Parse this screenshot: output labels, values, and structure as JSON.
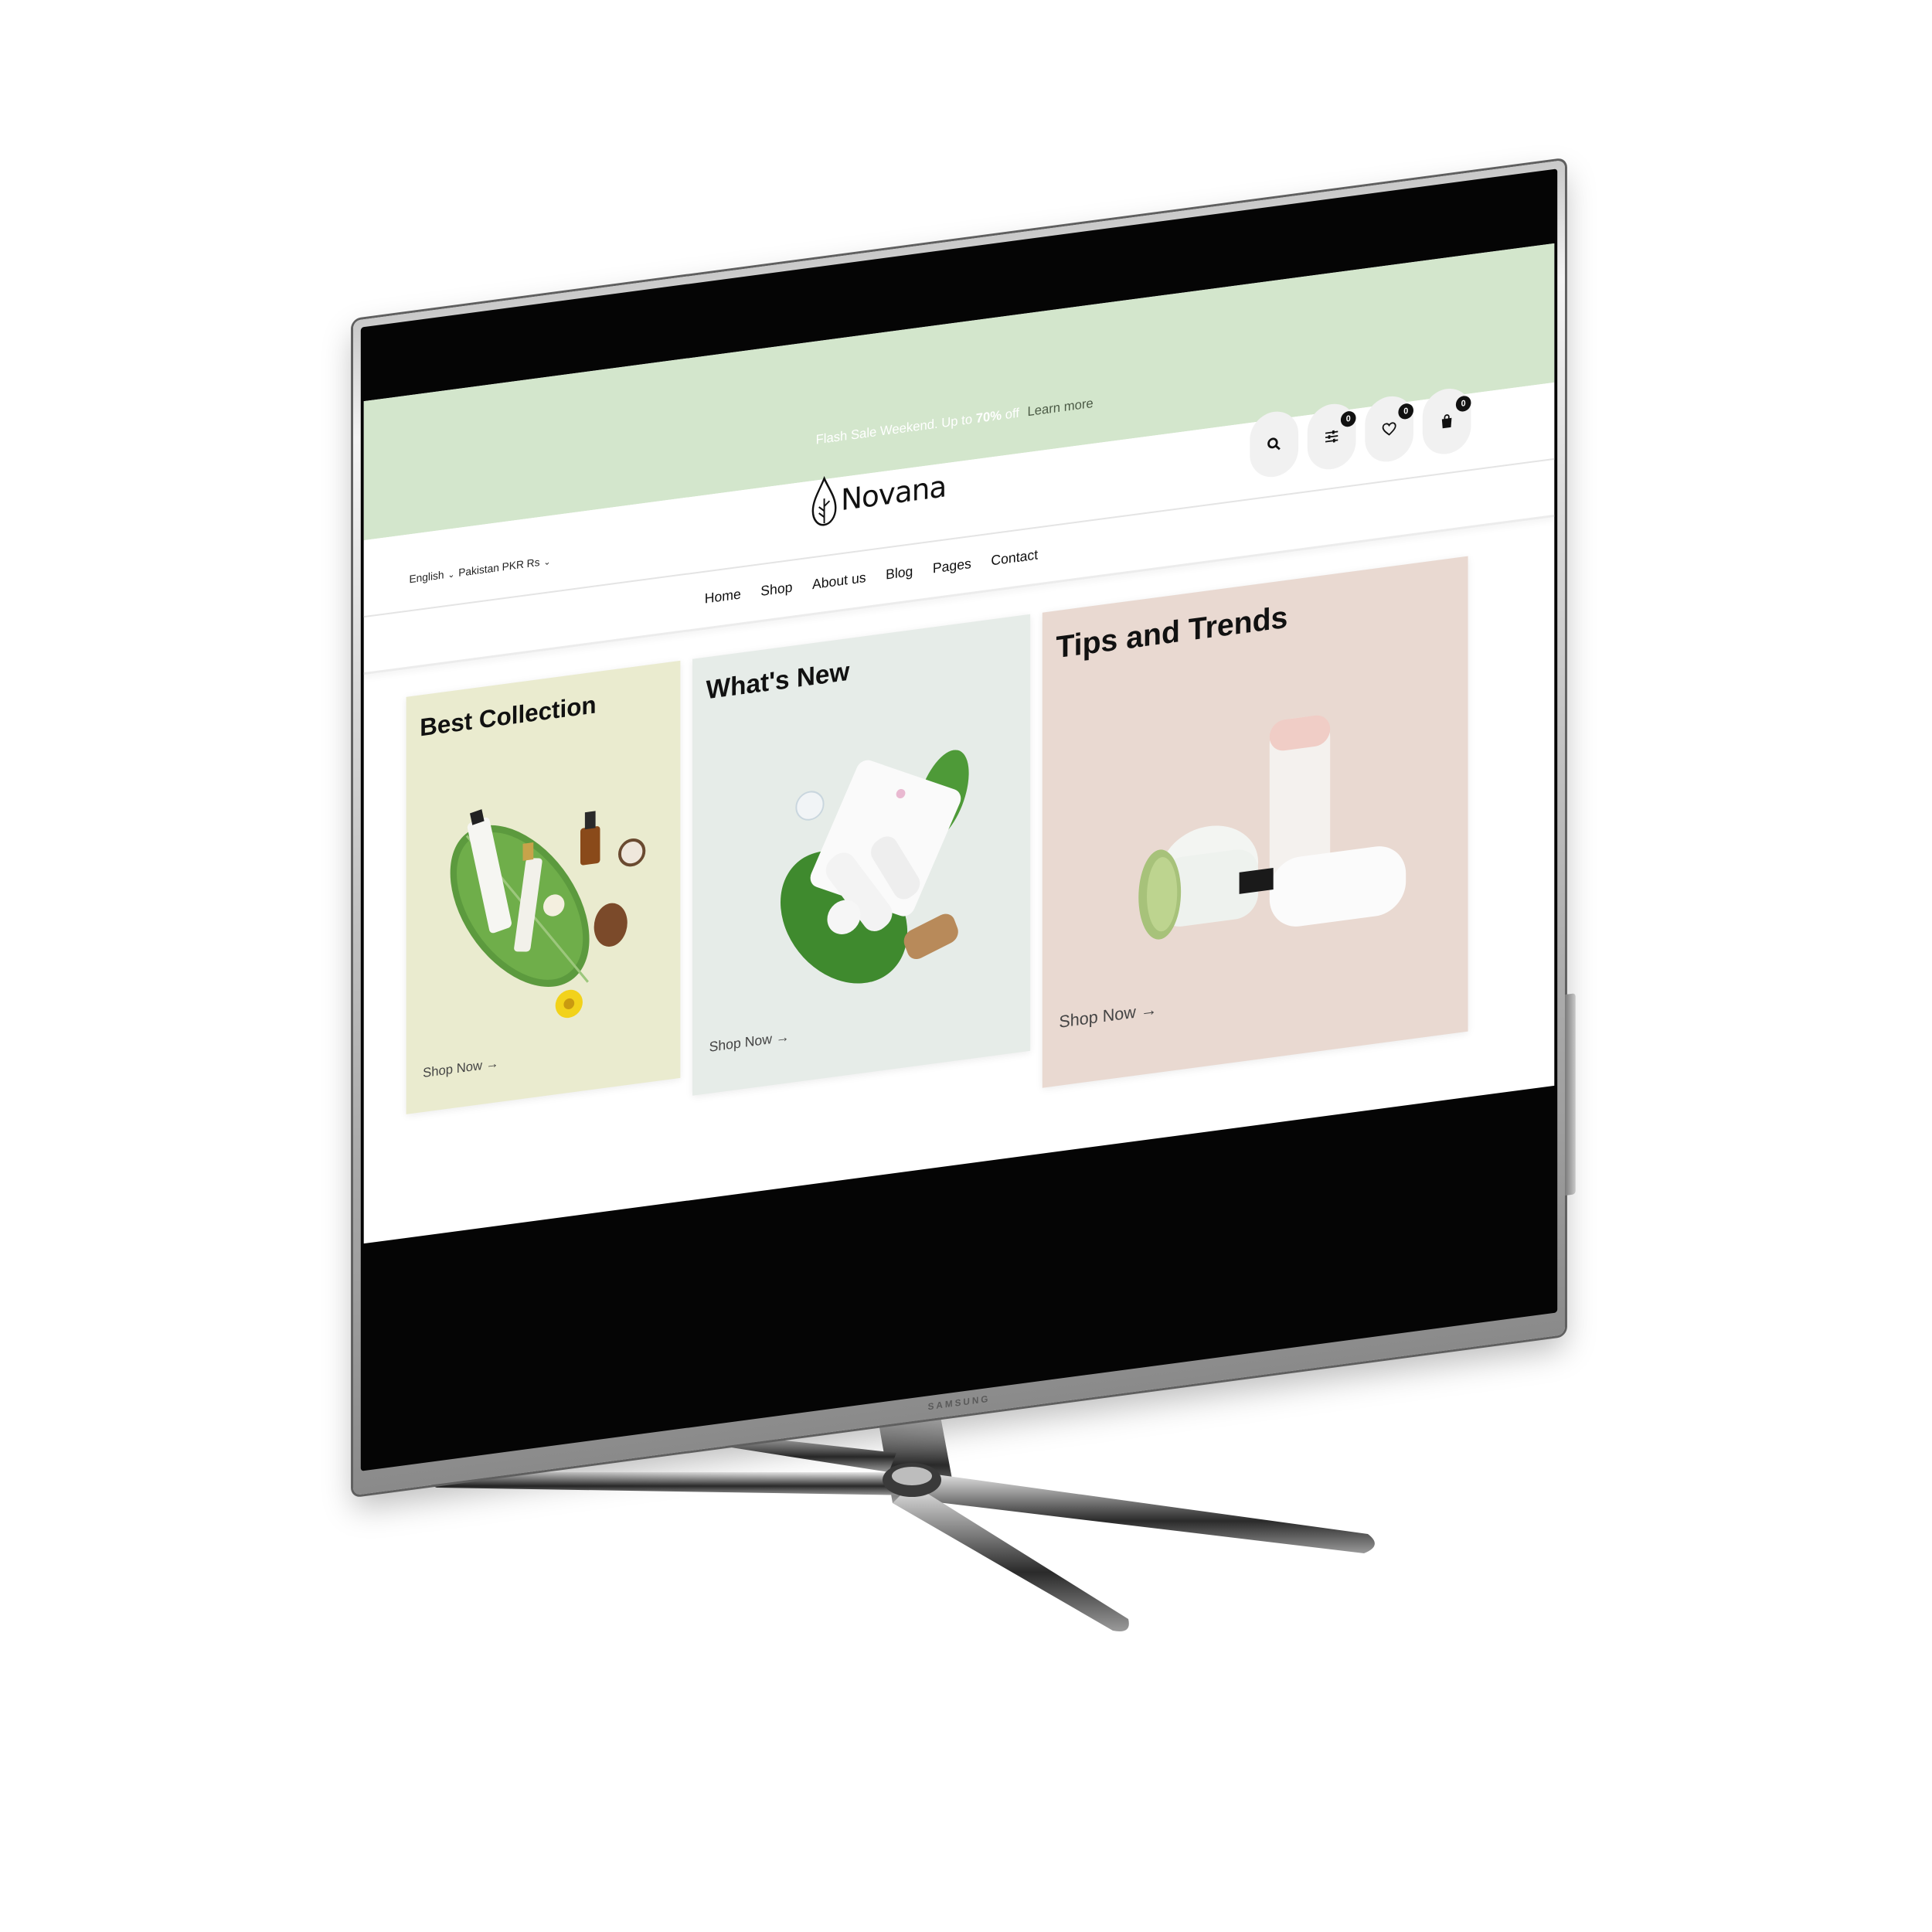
{
  "device": {
    "brand": "SAMSUNG"
  },
  "promo": {
    "text_before": "Flash Sale Weekend. Up to",
    "highlight": "70%",
    "text_after": "off",
    "link": "Learn more"
  },
  "header": {
    "language": "English",
    "currency": "Pakistan PKR Rs",
    "logo_text": "Novana",
    "compare_count": "0",
    "wishlist_count": "0",
    "cart_count": "0"
  },
  "nav": {
    "items": [
      {
        "label": "Home"
      },
      {
        "label": "Shop"
      },
      {
        "label": "About us"
      },
      {
        "label": "Blog"
      },
      {
        "label": "Pages"
      },
      {
        "label": "Contact"
      }
    ]
  },
  "cards": [
    {
      "title": "Best Collection",
      "link": "Shop Now →"
    },
    {
      "title": "What's New",
      "link": "Shop Now →"
    },
    {
      "title": "Tips and Trends",
      "link": "Shop Now →"
    }
  ],
  "colors": {
    "topbar": "#d3e6cc",
    "card1": "#eaebcf",
    "card2": "#e6ece8",
    "card3": "#e9d9d1"
  }
}
